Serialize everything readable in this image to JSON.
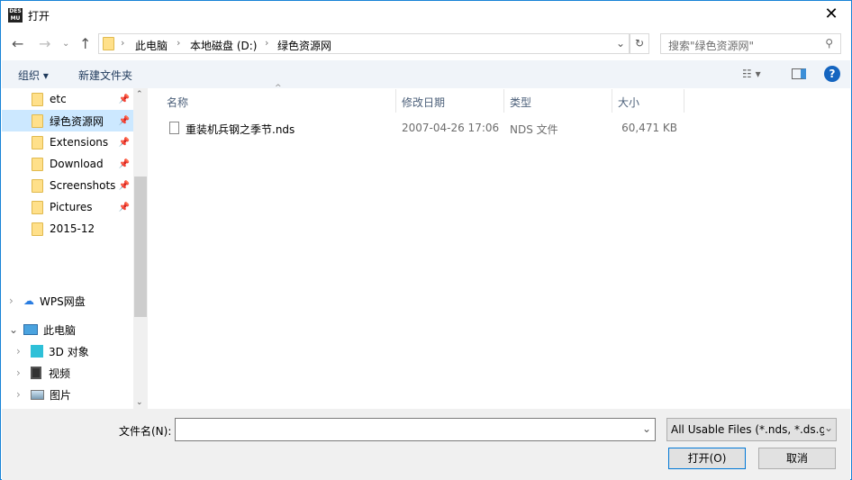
{
  "window": {
    "title": "打开",
    "close": "✕"
  },
  "address": {
    "crumbs": [
      "此电脑",
      "本地磁盘 (D:)",
      "绿色资源网"
    ],
    "search_placeholder": "搜索\"绿色资源网\""
  },
  "toolbar": {
    "organize": "组织 ▾",
    "new_folder": "新建文件夹"
  },
  "sidebar": {
    "quick": [
      "etc",
      "绿色资源网",
      "Extensions",
      "Download",
      "Screenshots",
      "Pictures",
      "2015-12"
    ],
    "wps": "WPS网盘",
    "pc": "此电脑",
    "pc_items": [
      "3D 对象",
      "视频",
      "图片"
    ]
  },
  "columns": {
    "name": "名称",
    "date": "修改日期",
    "type": "类型",
    "size": "大小"
  },
  "files": [
    {
      "name": "重装机兵钢之季节.nds",
      "date": "2007-04-26 17:06",
      "type": "NDS 文件",
      "size": "60,471 KB"
    }
  ],
  "bottom": {
    "filename_label": "文件名(N):",
    "filename_value": "",
    "filter": "All Usable Files (*.nds, *.ds.g",
    "open": "打开(O)",
    "cancel": "取消"
  }
}
